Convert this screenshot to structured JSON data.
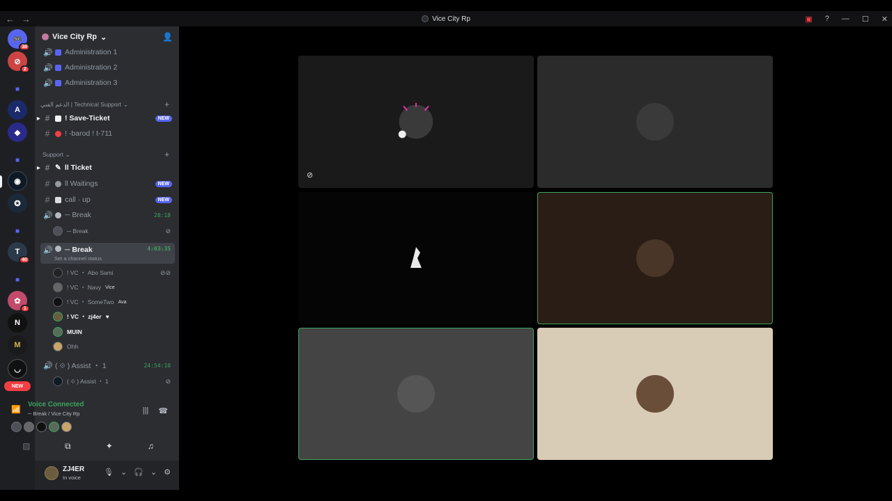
{
  "window": {
    "title": "Vice City Rp",
    "back": "←",
    "forward": "→",
    "controls": {
      "inbox": "▣",
      "help": "?",
      "minimize": "—",
      "maximize": "☐",
      "close": "✕"
    }
  },
  "rail": {
    "badges": [
      "38",
      "2",
      "40",
      "1"
    ],
    "new_label": "NEW"
  },
  "server": {
    "name": "Vice City Rp",
    "chevron": "⌄",
    "invite_icon": "👤"
  },
  "channels": {
    "admin": [
      "Administration 1",
      "Administration 2",
      "Administration 3"
    ],
    "tech_category": "الدعم الفني | Technical Support",
    "save_ticket": "! Save-Ticket",
    "barod": "! -barod ! t-711",
    "support_category": "Support",
    "ticket": "ll Ticket",
    "waitings": "ll Waitings",
    "call_up": "call · up",
    "break1": "─ Break",
    "break1_timer": "28:18",
    "break1_user": "─ Break",
    "break2": "─ Break",
    "break2_timer": "4:03:35",
    "break2_status": "Set a channel status",
    "assist": "( ⟐ ) Assist ・ 1",
    "assist_timer": "24:54:10",
    "assist_user": "( ⟐ ) Assist ・ 1",
    "new_label": "NEW"
  },
  "voice_users": [
    {
      "name": "! VC ・ Abo Sami",
      "tag": ""
    },
    {
      "name": "! VC ・ Navy",
      "tag": "Vice"
    },
    {
      "name": "! VC ・ SomeTwo",
      "tag": "Ava"
    },
    {
      "name": "! VC ・ zj4er",
      "tag": ""
    },
    {
      "name": "MUIN",
      "tag": ""
    },
    {
      "name": "Ohh",
      "tag": ""
    }
  ],
  "voice_panel": {
    "title": "Voice Connected",
    "subtitle": "─ Break / Vice City Rp"
  },
  "user_panel": {
    "name": "ZJ4ER",
    "status": "In voice"
  },
  "tiles": [
    {
      "name": "tile-1",
      "bg": "#1a1a1a",
      "avatar": "#2b2b2b",
      "speaking": false
    },
    {
      "name": "tile-2",
      "bg": "#2b2b2b",
      "avatar": "#3a3a3a",
      "speaking": false
    },
    {
      "name": "tile-3",
      "bg": "#050505",
      "avatar": "#111111",
      "speaking": false
    },
    {
      "name": "tile-4",
      "bg": "#2a1d16",
      "avatar": "#4a3628",
      "speaking": true
    },
    {
      "name": "tile-5",
      "bg": "#444444",
      "avatar": "#555555",
      "speaking": true
    },
    {
      "name": "tile-6",
      "bg": "#d8ccb6",
      "avatar": "#6a4e3a",
      "speaking": false
    }
  ],
  "colors": {
    "accent": "#5865f2",
    "voice_green": "#3ba55d",
    "danger": "#f23f43"
  }
}
